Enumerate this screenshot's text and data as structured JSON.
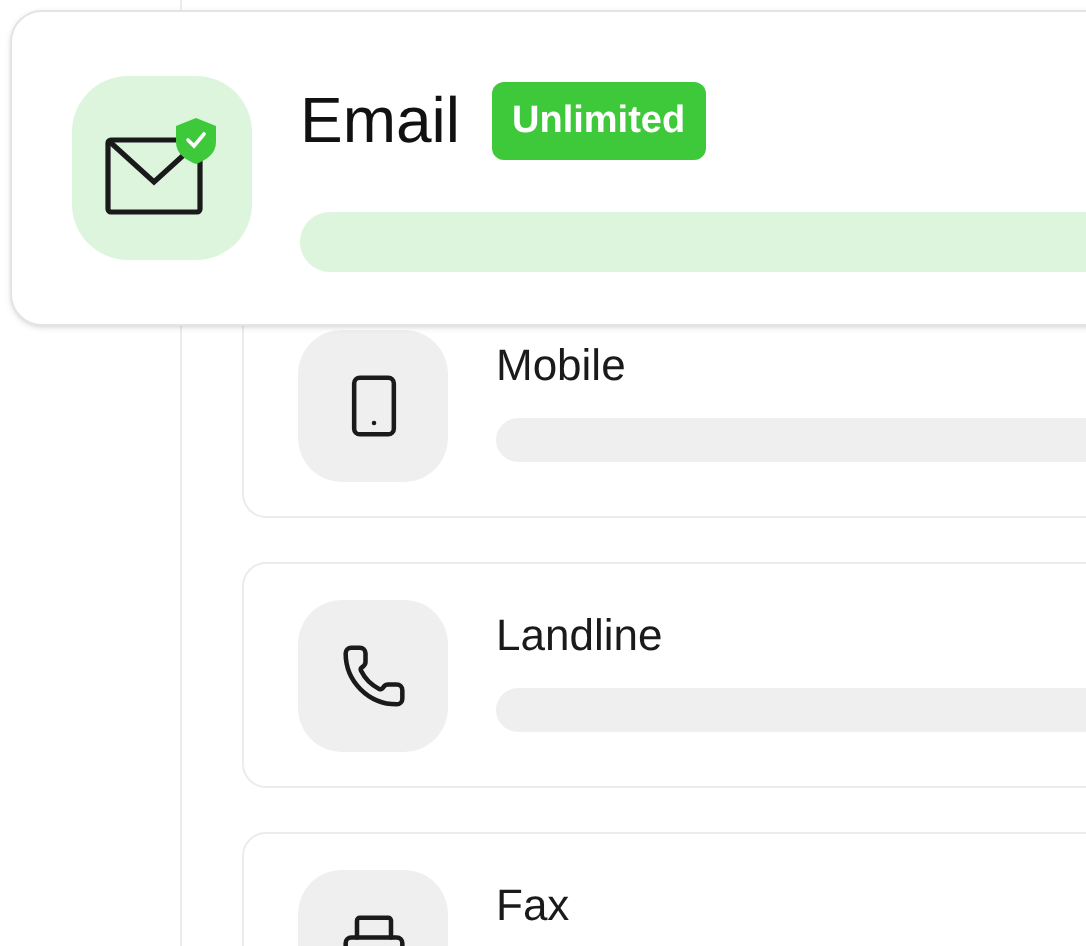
{
  "featured": {
    "kind": "email",
    "name": "Email",
    "badge": "Unlimited"
  },
  "channels": [
    {
      "kind": "mobile",
      "name": "Mobile"
    },
    {
      "kind": "landline",
      "name": "Landline"
    },
    {
      "kind": "fax",
      "name": "Fax"
    }
  ]
}
